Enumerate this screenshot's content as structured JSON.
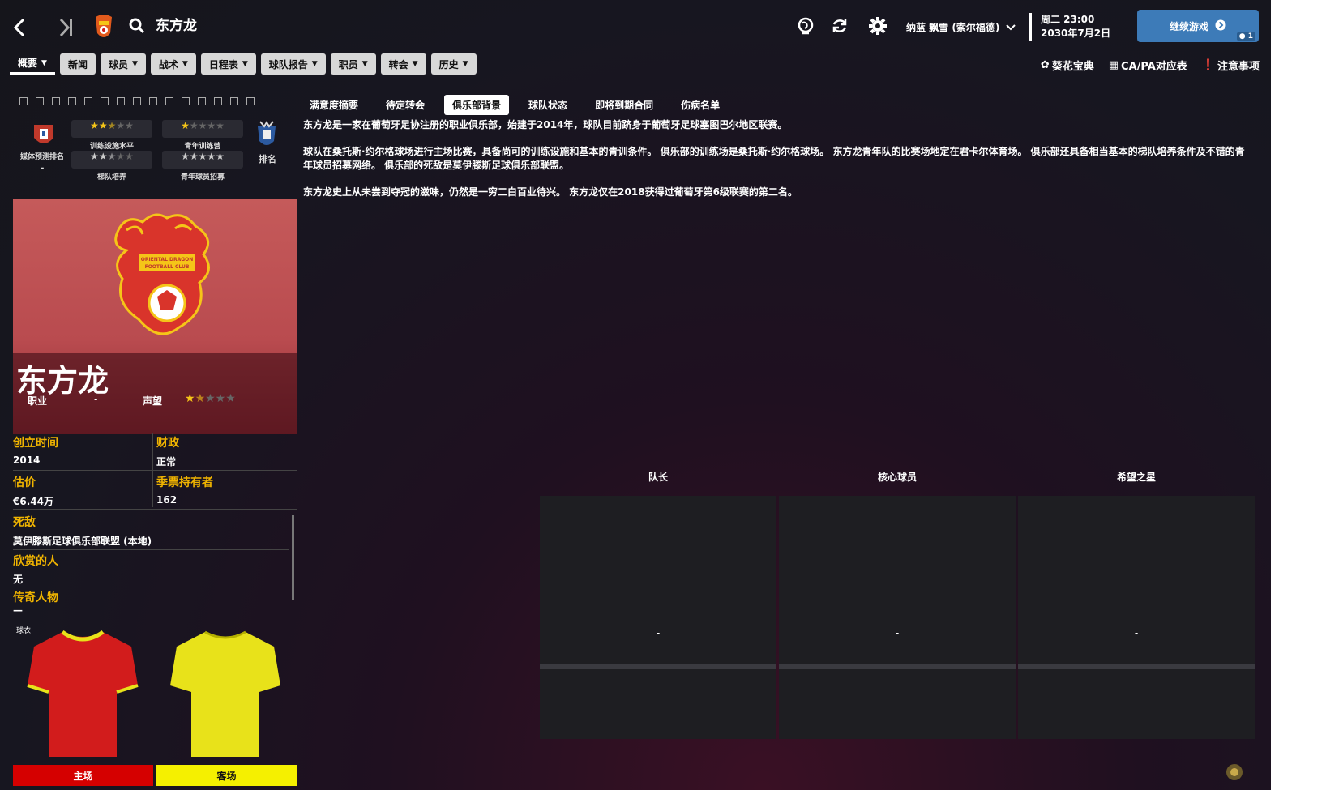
{
  "topbar": {
    "club_title": "东方龙",
    "manager": "纳蓝 飘雪 (索尔福德)",
    "day_time": "周二 23:00",
    "date": "2030年7月2日",
    "continue_label": "继续游戏",
    "continue_badge": "1"
  },
  "nav": {
    "items": [
      "概要",
      "新闻",
      "球员",
      "战术",
      "日程表",
      "球队报告",
      "职员",
      "转会",
      "历史"
    ]
  },
  "right_links": [
    "葵花宝典",
    "CA/PA对应表",
    "注意事项"
  ],
  "subtabs": [
    "满意度摘要",
    "待定转会",
    "俱乐部背景",
    "球队状态",
    "即将到期合同",
    "伤病名单"
  ],
  "ratings": {
    "media_rank_label": "媒体预测排名",
    "media_rank_value": "-",
    "training_facilities": {
      "label": "训练设施水平",
      "stars": 2.5
    },
    "youth_training": {
      "label": "青年训练营",
      "stars": 1
    },
    "squad_development": {
      "label": "梯队培养",
      "stars": 2.5
    },
    "youth_recruitment": {
      "label": "青年球员招募",
      "stars": 5
    },
    "rank_label": "排名"
  },
  "hero": {
    "name": "东方龙",
    "type_label": "职业",
    "type_value": "-",
    "rep_label": "声望",
    "rep_stars": 1.5,
    "dash1": "-",
    "dash2": "-"
  },
  "info": {
    "founded_label": "创立时间",
    "founded_value": "2014",
    "finance_label": "财政",
    "finance_value": "正常",
    "valuation_label": "估价",
    "valuation_value": "€6.44万",
    "season_ticket_label": "季票持有者",
    "season_ticket_value": "162",
    "rival_label": "死敌",
    "rival_value": "莫伊滕斯足球俱乐部联盟 (本地)",
    "admired_label": "欣赏的人",
    "admired_value": "无",
    "legend_label": "传奇人物",
    "legend_value": "—"
  },
  "kits": {
    "label": "球衣",
    "home_label": "主场",
    "away_label": "客场",
    "home_color": "#d21c1c",
    "away_color": "#e8e21a"
  },
  "description": [
    "东方龙是一家在葡萄牙足协注册的职业俱乐部，始建于2014年，球队目前跻身于葡萄牙足球塞图巴尔地区联赛。",
    "球队在桑托斯·约尔格球场进行主场比赛，具备尚可的训练设施和基本的青训条件。 俱乐部的训练场是桑托斯·约尔格球场。 东方龙青年队的比赛场地定在君卡尔体育场。 俱乐部还具备相当基本的梯队培养条件及不错的青年球员招募网络。 俱乐部的死敌是莫伊滕斯足球俱乐部联盟。",
    "东方龙史上从未尝到夺冠的滋味，仍然是一穷二白百业待兴。 东方龙仅在2018获得过葡萄牙第6级联赛的第二名。"
  ],
  "cards": [
    {
      "title": "队长",
      "value": "-"
    },
    {
      "title": "核心球员",
      "value": "-"
    },
    {
      "title": "希望之星",
      "value": "-"
    }
  ],
  "crest_text": [
    "ORIENTAL DRAGON",
    "FOOTBALL CLUB"
  ]
}
